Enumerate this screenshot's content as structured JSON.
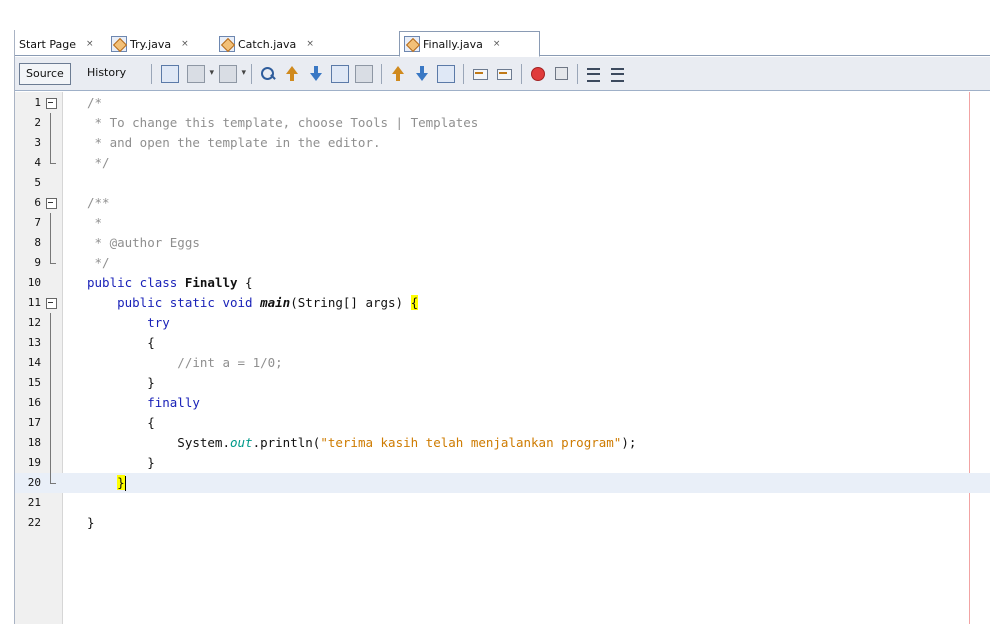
{
  "tabs": [
    {
      "label": "Start Page",
      "close": "×",
      "active": false
    },
    {
      "label": "Try.java",
      "close": "×",
      "active": false
    },
    {
      "label": "Catch.java",
      "close": "×",
      "active": false
    },
    {
      "label": "Finally.java",
      "close": "×",
      "active": true
    }
  ],
  "toolbar": {
    "source_label": "Source",
    "history_label": "History"
  },
  "editor": {
    "current_line": 20,
    "lines": [
      {
        "n": "1"
      },
      {
        "n": "2"
      },
      {
        "n": "3"
      },
      {
        "n": "4"
      },
      {
        "n": "5"
      },
      {
        "n": "6"
      },
      {
        "n": "7"
      },
      {
        "n": "8"
      },
      {
        "n": "9"
      },
      {
        "n": "10"
      },
      {
        "n": "11"
      },
      {
        "n": "12"
      },
      {
        "n": "13"
      },
      {
        "n": "14"
      },
      {
        "n": "15"
      },
      {
        "n": "16"
      },
      {
        "n": "17"
      },
      {
        "n": "18"
      },
      {
        "n": "19"
      },
      {
        "n": "20"
      },
      {
        "n": "21"
      },
      {
        "n": "22"
      }
    ],
    "code": {
      "l1": "/*",
      "l2": " * To change this template, choose Tools | Templates",
      "l3": " * and open the template in the editor.",
      "l4": " */",
      "l6": "/**",
      "l7": " *",
      "l8": " * @author Eggs",
      "l9": " */",
      "l10_kw": "public class ",
      "l10_name": "Finally",
      "l10_rest": " {",
      "l11_kw": "    public static void ",
      "l11_method": "main",
      "l11_rest": "(String[] args) ",
      "l11_brace": "{",
      "l12": "        try",
      "l13": "        {",
      "l14": "            //int a = 1/0;",
      "l15": "        }",
      "l16": "        finally",
      "l17": "        {",
      "l18_a": "            System.",
      "l18_field": "out",
      "l18_b": ".println(",
      "l18_str": "\"terima kasih telah menjalankan program\"",
      "l18_c": ");",
      "l19": "        }",
      "l20_pad": "    ",
      "l20_brace": "}",
      "l22": "}"
    }
  },
  "colors": {
    "keyword": "#1a22b8",
    "comment": "#8f8f8f",
    "string": "#ce7b00",
    "field": "#009a8a",
    "brace_match": "#ffff00",
    "current_line": "#e9eff8"
  }
}
